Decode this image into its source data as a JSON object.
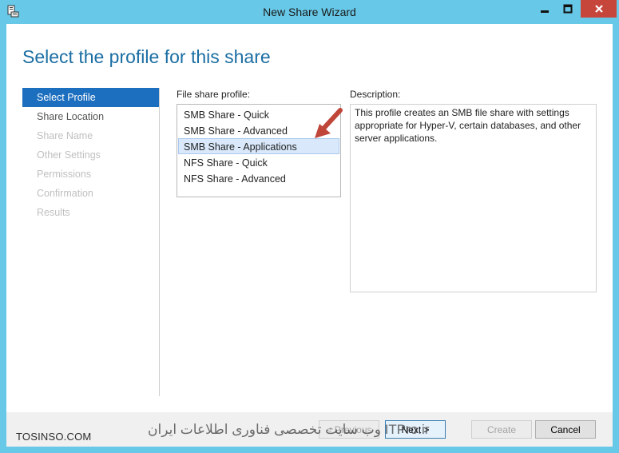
{
  "window": {
    "title": "New Share Wizard",
    "controls": {
      "minimize": "minimize",
      "maximize": "maximize",
      "close": "close"
    },
    "accent_color": "#67c8e7",
    "close_color": "#c7463c"
  },
  "page": {
    "title": "Select the profile for this share"
  },
  "nav": {
    "items": [
      {
        "label": "Select Profile",
        "state": "active"
      },
      {
        "label": "Share Location",
        "state": "enabled"
      },
      {
        "label": "Share Name",
        "state": "disabled"
      },
      {
        "label": "Other Settings",
        "state": "disabled"
      },
      {
        "label": "Permissions",
        "state": "disabled"
      },
      {
        "label": "Confirmation",
        "state": "disabled"
      },
      {
        "label": "Results",
        "state": "disabled"
      }
    ]
  },
  "profiles": {
    "label": "File share profile:",
    "items": [
      "SMB Share - Quick",
      "SMB Share - Advanced",
      "SMB Share - Applications",
      "NFS Share - Quick",
      "NFS Share - Advanced"
    ],
    "selected": "SMB Share - Applications"
  },
  "description": {
    "label": "Description:",
    "text": "This profile creates an SMB file share with settings appropriate for Hyper-V, certain databases, and other server applications."
  },
  "buttons": {
    "previous": "< Previous",
    "next": "Next >",
    "create": "Create",
    "cancel": "Cancel"
  },
  "watermark": {
    "left": "TOSINSO.COM",
    "right": "وب سایت تخصصی فناوری اطلاعات ایران ITPro.ir"
  }
}
